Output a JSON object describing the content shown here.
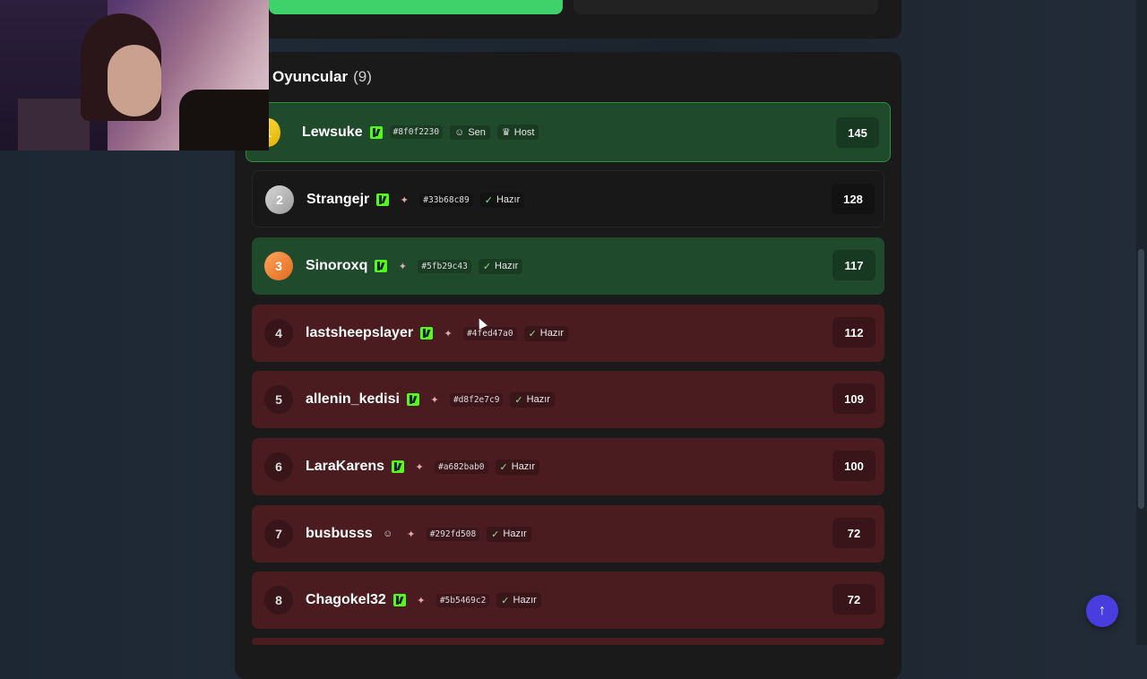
{
  "section": {
    "title": "Oyuncular",
    "count": "(9)"
  },
  "colors": {
    "green_row": "#1f4a2b",
    "dark_row": "#181818",
    "red_row": "#4a1c20",
    "accent": "#4a3de0"
  },
  "players": [
    {
      "rank": "1",
      "name": "Lewsuke",
      "kick": true,
      "hash": "#8f0f2230",
      "tags": [
        "Sen",
        "Host"
      ],
      "score": "145",
      "style": "me"
    },
    {
      "rank": "2",
      "name": "Strangejr",
      "kick": true,
      "hash": "#33b68c89",
      "tags": [
        "Hazır"
      ],
      "score": "128",
      "style": "dark"
    },
    {
      "rank": "3",
      "name": "Sinoroxq",
      "kick": true,
      "hash": "#5fb29c43",
      "tags": [
        "Hazır"
      ],
      "score": "117",
      "style": "green"
    },
    {
      "rank": "4",
      "name": "lastsheepslayer",
      "kick": true,
      "hash": "#4fed47a0",
      "tags": [
        "Hazır"
      ],
      "score": "112",
      "style": "red"
    },
    {
      "rank": "5",
      "name": "allenin_kedisi",
      "kick": true,
      "hash": "#d8f2e7c9",
      "tags": [
        "Hazır"
      ],
      "score": "109",
      "style": "red"
    },
    {
      "rank": "6",
      "name": "LaraKarens",
      "kick": true,
      "hash": "#a682bab0",
      "tags": [
        "Hazır"
      ],
      "score": "100",
      "style": "red"
    },
    {
      "rank": "7",
      "name": "busbusss",
      "kick": false,
      "hash": "#292fd508",
      "tags": [
        "Hazır"
      ],
      "score": "72",
      "style": "red"
    },
    {
      "rank": "8",
      "name": "Chagokel32",
      "kick": true,
      "hash": "#5b5469c2",
      "tags": [
        "Hazır"
      ],
      "score": "72",
      "style": "red"
    }
  ]
}
